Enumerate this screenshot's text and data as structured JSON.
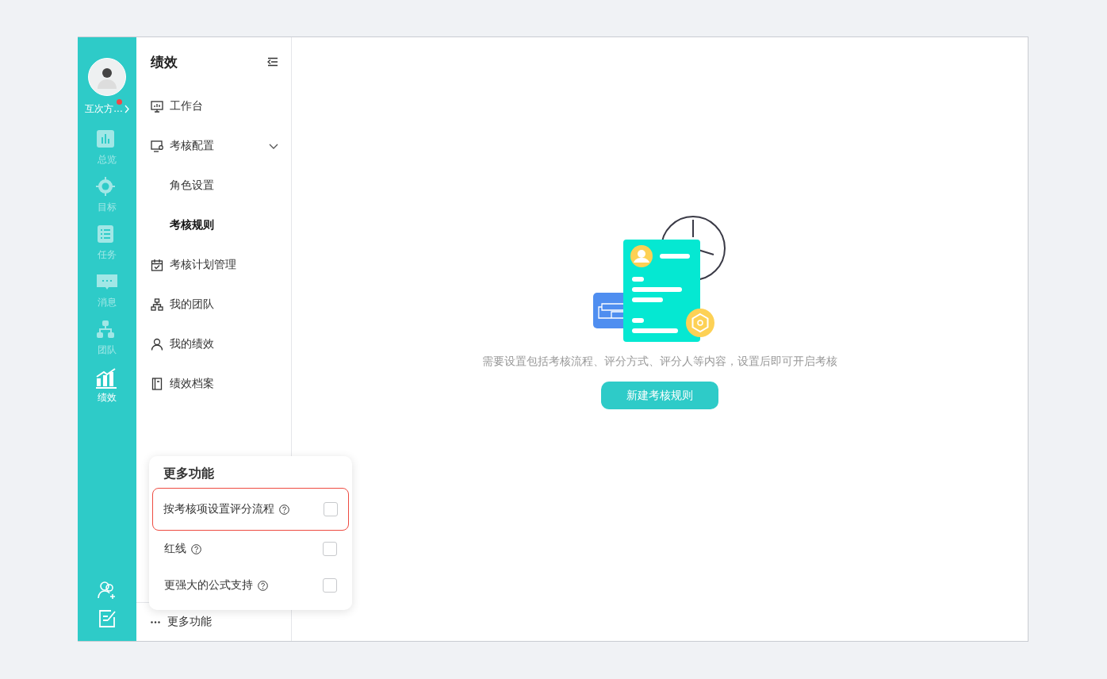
{
  "rail": {
    "user": {
      "name": "互次方...",
      "has_badge": true
    },
    "items": [
      {
        "label": "总览",
        "selected": false
      },
      {
        "label": "目标",
        "selected": false
      },
      {
        "label": "任务",
        "selected": false
      },
      {
        "label": "消息",
        "selected": false
      },
      {
        "label": "团队",
        "selected": false
      },
      {
        "label": "绩效",
        "selected": true
      }
    ]
  },
  "menu": {
    "title": "绩效",
    "items": [
      {
        "label": "工作台",
        "kind": "item",
        "selected": false
      },
      {
        "label": "考核配置",
        "kind": "group",
        "expanded": true,
        "children": [
          {
            "label": "角色设置",
            "selected": false
          },
          {
            "label": "考核规则",
            "selected": true
          }
        ]
      },
      {
        "label": "考核计划管理",
        "kind": "item",
        "selected": false
      },
      {
        "label": "我的团队",
        "kind": "item",
        "selected": false
      },
      {
        "label": "我的绩效",
        "kind": "item",
        "selected": false
      },
      {
        "label": "绩效档案",
        "kind": "item",
        "selected": false
      }
    ],
    "footer": "更多功能"
  },
  "popup": {
    "title": "更多功能",
    "options": [
      {
        "label": "按考核项设置评分流程",
        "checked": false,
        "highlighted": true
      },
      {
        "label": "红线",
        "checked": false,
        "highlighted": false
      },
      {
        "label": "更强大的公式支持",
        "checked": false,
        "highlighted": false
      }
    ]
  },
  "empty_state": {
    "message": "需要设置包括考核流程、评分方式、评分人等内容，设置后即可开启考核",
    "button": "新建考核规则"
  }
}
